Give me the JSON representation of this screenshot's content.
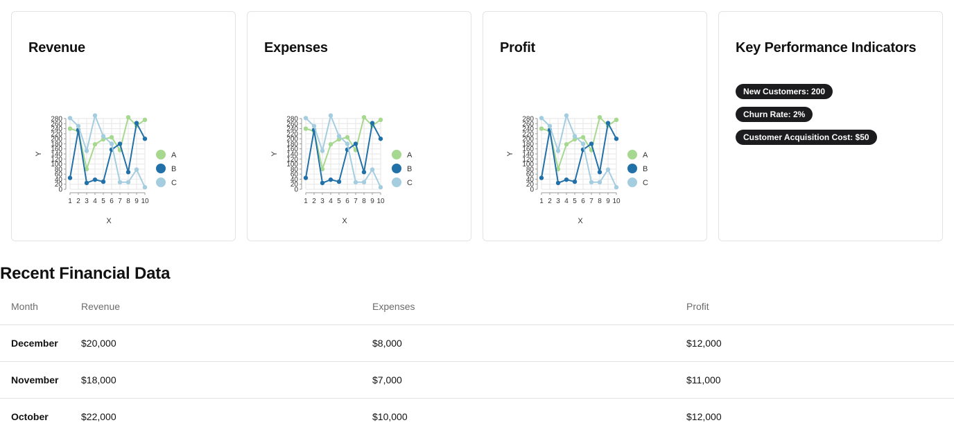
{
  "cards": [
    {
      "title": "Revenue"
    },
    {
      "title": "Expenses"
    },
    {
      "title": "Profit"
    }
  ],
  "kpi": {
    "title": "Key Performance Indicators",
    "badges": [
      "New Customers: 200",
      "Churn Rate: 2%",
      "Customer Acquisition Cost: $50"
    ]
  },
  "table": {
    "title": "Recent Financial Data",
    "headers": [
      "Month",
      "Revenue",
      "Expenses",
      "Profit"
    ],
    "rows": [
      [
        "December",
        "$20,000",
        "$8,000",
        "$12,000"
      ],
      [
        "November",
        "$18,000",
        "$7,000",
        "$11,000"
      ],
      [
        "October",
        "$22,000",
        "$10,000",
        "$12,000"
      ]
    ]
  },
  "colors": {
    "A": "#a6d88f",
    "B": "#2170a8",
    "C": "#a5cde0"
  },
  "chart_data": [
    {
      "type": "line",
      "x": [
        1,
        2,
        3,
        4,
        5,
        6,
        7,
        8,
        9,
        10
      ],
      "xlabel": "X",
      "ylabel": "Y",
      "xlim": [
        1,
        10
      ],
      "ylim": [
        0,
        280
      ],
      "yticks": [
        0,
        20,
        40,
        60,
        80,
        100,
        120,
        140,
        160,
        180,
        200,
        220,
        240,
        260,
        280
      ],
      "grid": true,
      "legend": "right",
      "series": [
        {
          "name": "A",
          "values": [
            240,
            230,
            80,
            178,
            198,
            206,
            155,
            285,
            252,
            275
          ]
        },
        {
          "name": "B",
          "values": [
            45,
            235,
            25,
            38,
            30,
            157,
            180,
            68,
            262,
            200
          ]
        },
        {
          "name": "C",
          "values": [
            282,
            250,
            152,
            292,
            210,
            180,
            28,
            28,
            78,
            8
          ]
        }
      ]
    },
    {
      "type": "line",
      "x": [
        1,
        2,
        3,
        4,
        5,
        6,
        7,
        8,
        9,
        10
      ],
      "xlabel": "X",
      "ylabel": "Y",
      "xlim": [
        1,
        10
      ],
      "ylim": [
        0,
        280
      ],
      "yticks": [
        0,
        20,
        40,
        60,
        80,
        100,
        120,
        140,
        160,
        180,
        200,
        220,
        240,
        260,
        280
      ],
      "grid": true,
      "legend": "right",
      "series": [
        {
          "name": "A",
          "values": [
            240,
            230,
            80,
            178,
            198,
            206,
            155,
            285,
            252,
            275
          ]
        },
        {
          "name": "B",
          "values": [
            45,
            235,
            25,
            38,
            30,
            157,
            180,
            68,
            262,
            200
          ]
        },
        {
          "name": "C",
          "values": [
            282,
            250,
            152,
            292,
            210,
            180,
            28,
            28,
            78,
            8
          ]
        }
      ]
    },
    {
      "type": "line",
      "x": [
        1,
        2,
        3,
        4,
        5,
        6,
        7,
        8,
        9,
        10
      ],
      "xlabel": "X",
      "ylabel": "Y",
      "xlim": [
        1,
        10
      ],
      "ylim": [
        0,
        280
      ],
      "yticks": [
        0,
        20,
        40,
        60,
        80,
        100,
        120,
        140,
        160,
        180,
        200,
        220,
        240,
        260,
        280
      ],
      "grid": true,
      "legend": "right",
      "series": [
        {
          "name": "A",
          "values": [
            240,
            230,
            80,
            178,
            198,
            206,
            155,
            285,
            252,
            275
          ]
        },
        {
          "name": "B",
          "values": [
            45,
            235,
            25,
            38,
            30,
            157,
            180,
            68,
            262,
            200
          ]
        },
        {
          "name": "C",
          "values": [
            282,
            250,
            152,
            292,
            210,
            180,
            28,
            28,
            78,
            8
          ]
        }
      ]
    }
  ]
}
